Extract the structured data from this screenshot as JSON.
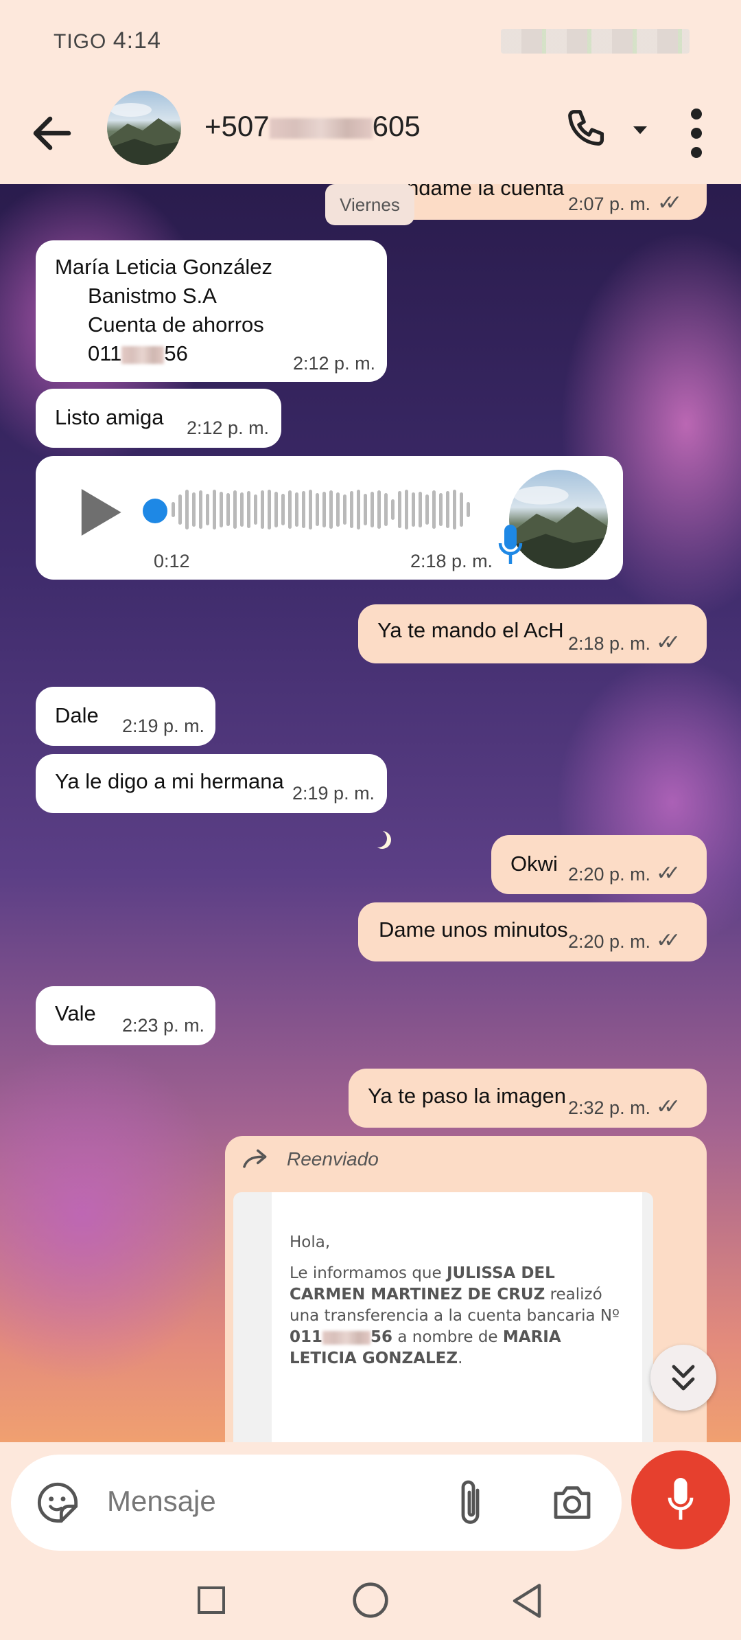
{
  "status": {
    "carrier": "TIGO",
    "time": "4:14"
  },
  "header": {
    "contact_prefix": "+507",
    "contact_suffix": "605"
  },
  "chat": {
    "day_chip": "Viernes",
    "messages": [
      {
        "id": "m0",
        "dir": "out",
        "text": "Mandame la cuenta",
        "time": "2:07 p. m."
      },
      {
        "id": "m1",
        "dir": "in",
        "lines": [
          "María Leticia González",
          "Banistmo S.A",
          "Cuenta de ahorros",
          "011",
          "56"
        ],
        "time": "2:12 p. m."
      },
      {
        "id": "m2",
        "dir": "in",
        "text": "Listo amiga",
        "time": "2:12 p. m."
      },
      {
        "id": "m3",
        "dir": "in",
        "type": "voice",
        "duration": "0:12",
        "time": "2:18 p. m."
      },
      {
        "id": "m4",
        "dir": "out",
        "text": "Ya te mando el AcH",
        "time": "2:18 p. m."
      },
      {
        "id": "m5",
        "dir": "in",
        "text": "Dale",
        "time": "2:19 p. m."
      },
      {
        "id": "m6",
        "dir": "in",
        "text": "Ya le digo a mi hermana",
        "time": "2:19 p. m."
      },
      {
        "id": "m7",
        "dir": "out",
        "text": "Okwi",
        "time": "2:20 p. m."
      },
      {
        "id": "m8",
        "dir": "out",
        "text": "Dame unos minutos",
        "time": "2:20 p. m."
      },
      {
        "id": "m9",
        "dir": "in",
        "text": "Vale",
        "time": "2:23 p. m."
      },
      {
        "id": "m10",
        "dir": "out",
        "text": "Ya te paso la imagen",
        "time": "2:32 p. m."
      }
    ],
    "forwarded": {
      "label": "Reenviado",
      "greeting": "Hola,",
      "body_a": "Le informamos que ",
      "sender": "JULISSA DEL CARMEN MARTINEZ DE CRUZ",
      "body_b": " realizó una transferencia a la cuenta bancaria Nº ",
      "account_a": "011",
      "account_b": "56",
      "body_c": " a nombre de ",
      "recipient": "MARIA LETICIA GONZALEZ",
      "end": "."
    }
  },
  "composer": {
    "placeholder": "Mensaje"
  },
  "colors": {
    "incoming": "#ffffff",
    "outgoing": "#fcdcc6",
    "mic_fab": "#e6402e",
    "voice_dot": "#1e88e5"
  }
}
